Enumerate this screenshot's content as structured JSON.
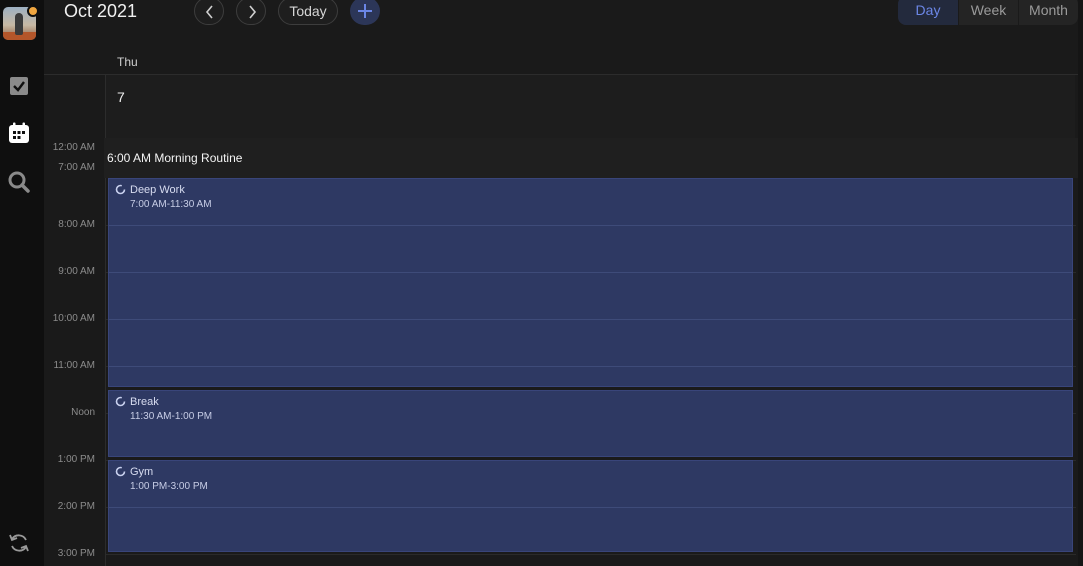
{
  "header": {
    "month_title": "Oct 2021",
    "today_label": "Today",
    "views": [
      {
        "label": "Day",
        "active": true
      },
      {
        "label": "Week",
        "active": false
      },
      {
        "label": "Month",
        "active": false
      }
    ]
  },
  "rail": {
    "icons": [
      "avatar",
      "check-square-icon",
      "calendar-icon",
      "search-icon",
      "sync-icon"
    ]
  },
  "day": {
    "name": "Thu",
    "number": "7"
  },
  "collapsed": {
    "range_start": "12:00 AM",
    "range_end": "7:00 AM",
    "event_text": "6:00 AM Morning Routine"
  },
  "time_labels": [
    "8:00 AM",
    "9:00 AM",
    "10:00 AM",
    "11:00 AM",
    "Noon",
    "1:00 PM",
    "2:00 PM",
    "3:00 PM"
  ],
  "events": [
    {
      "title": "Deep Work",
      "time": "7:00 AM-11:30 AM"
    },
    {
      "title": "Break",
      "time": "11:30 AM-1:00 PM"
    },
    {
      "title": "Gym",
      "time": "1:00 PM-3:00 PM"
    }
  ],
  "colors": {
    "accent": "#6b86e6",
    "event_bg": "#2e3963",
    "background": "#1a1a1a"
  }
}
